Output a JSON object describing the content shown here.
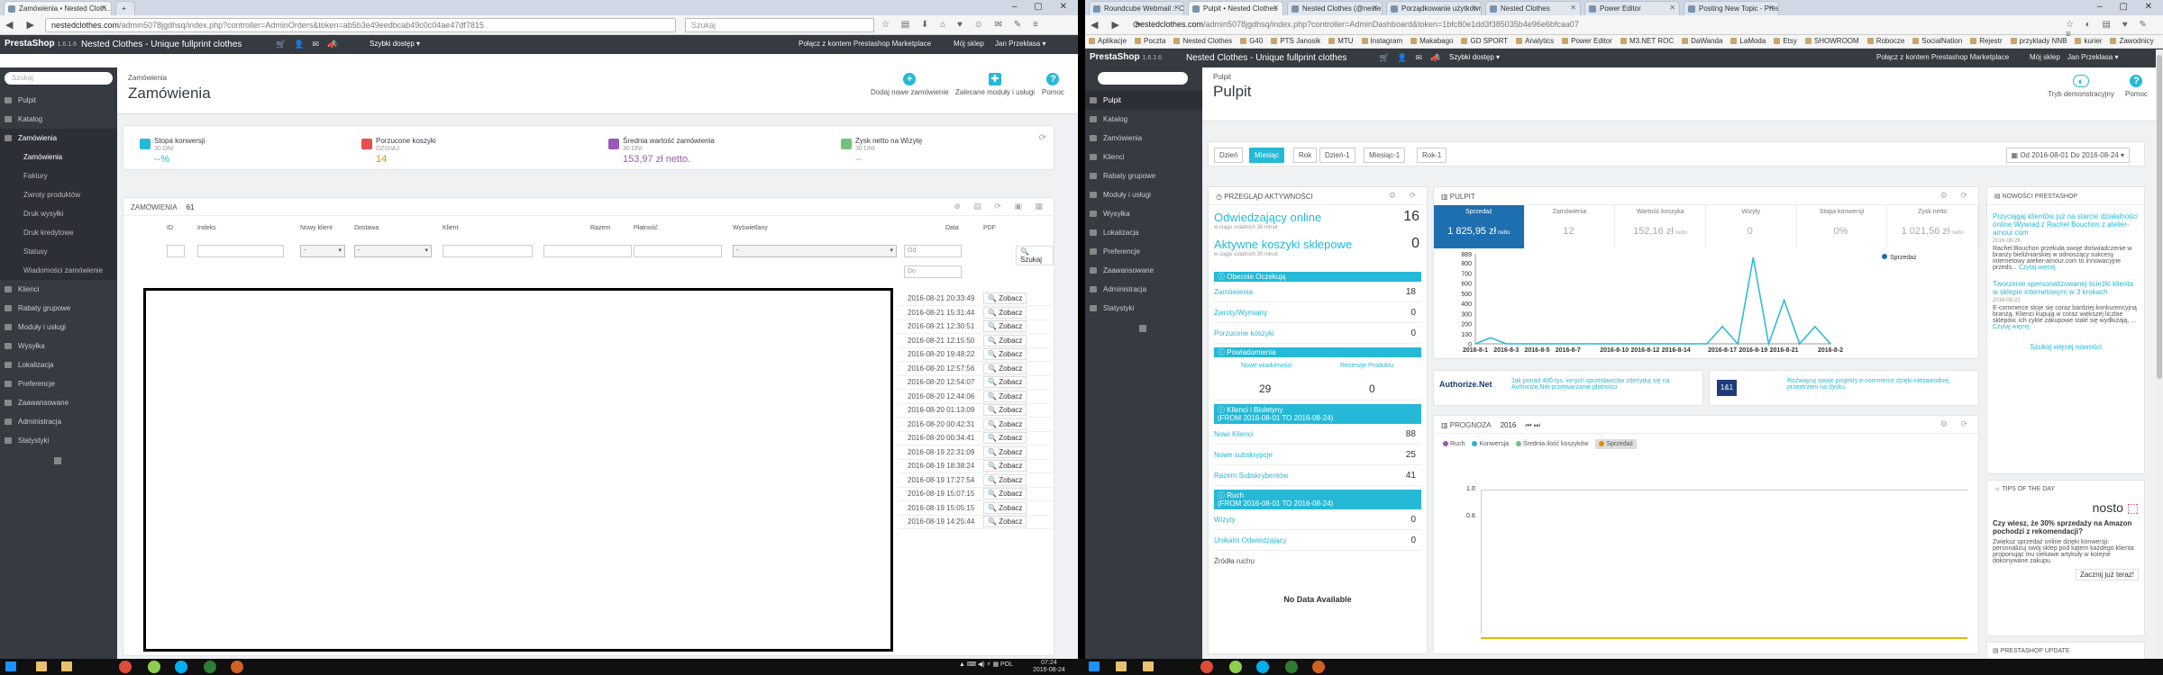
{
  "left_window": {
    "tabs": [
      {
        "label": "Zamówienia • Nested Cloth..."
      }
    ],
    "url_host": "nestedclothes.com",
    "url_path": "/admin5078jgdhsq/index.php?controller=AdminOrders&token=ab5b3e49eedbcab49c0c04ae47df7815",
    "search_placeholder": "Szukaj",
    "ps": {
      "logo": "PrestaShop",
      "version": "1.6.1.6",
      "shop_name": "Nested Clothes - Unique fullprint clothes",
      "quick_access": "Szybki dostęp",
      "marketplace": "Połącz z kontem Prestashop Marketplace",
      "my_shop": "Mój sklep",
      "user": "Jan Przeklasa"
    },
    "sidebar": {
      "search_placeholder": "Szukaj",
      "items": [
        {
          "label": "Pulpit"
        },
        {
          "label": "Katalog"
        },
        {
          "label": "Zamówienia"
        },
        {
          "label": "Klienci"
        },
        {
          "label": "Rabaty grupowe"
        },
        {
          "label": "Moduły i usługi"
        },
        {
          "label": "Wysyłka"
        },
        {
          "label": "Lokalizacja"
        },
        {
          "label": "Preferencje"
        },
        {
          "label": "Zaawansowane"
        },
        {
          "label": "Administracja"
        },
        {
          "label": "Statystyki"
        }
      ],
      "subitems": [
        {
          "label": "Zamówienia"
        },
        {
          "label": "Faktury"
        },
        {
          "label": "Zwroty produktów"
        },
        {
          "label": "Druk wysyłki"
        },
        {
          "label": "Druk kredytowe"
        },
        {
          "label": "Statusy"
        },
        {
          "label": "Wiadomości zamówienie"
        }
      ]
    },
    "page": {
      "breadcrumb": "Zamówienia",
      "title": "Zamówienia",
      "buttons": {
        "add": "Dodaj nowe zamówienie",
        "recommended": "Zalecane moduły i usługi",
        "help": "Pomoc"
      }
    },
    "kpis": [
      {
        "title": "Stopa konwersji",
        "sub": "30 DNI",
        "value": "--%",
        "color": "#25b9d7"
      },
      {
        "title": "Porzucone koszyki",
        "sub": "DZISIAJ",
        "value": "14",
        "color": "#e08f00"
      },
      {
        "title": "Średnia wartość zamówienia",
        "sub": "30 DNI",
        "value": "153,97 zł netto.",
        "color": "#9b59b6"
      },
      {
        "title": "Zysk netto na Wizytę",
        "sub": "30 DNI",
        "value": "--",
        "color": "#72c279"
      }
    ],
    "orders": {
      "title": "ZAMÓWIENIA",
      "count": "61",
      "columns": [
        "ID",
        "Indeks",
        "Nowy klient",
        "Dostawa",
        "Klient",
        "Razem",
        "Płatność",
        "Wyświetlany",
        "Data",
        "PDF"
      ],
      "filter_from": "Od",
      "filter_to": "Do",
      "search_button": "Szukaj",
      "view_label": "Zobacz",
      "dates": [
        "2016-08-21 20:33:49",
        "2016-08-21 15:31:44",
        "2016-08-21 12:30:51",
        "2016-08-21 12:15:50",
        "2016-08-20 19:48:22",
        "2016-08-20 12:57:56",
        "2016-08-20 12:54:07",
        "2016-08-20 12:44:06",
        "2016-08-20 01:13:09",
        "2016-08-20 00:42:31",
        "2016-08-20 00:34:41",
        "2016-08-19 22:31:09",
        "2016-08-19 18:38:24",
        "2016-08-19 17:27:54",
        "2016-08-19 15:07:15",
        "2016-08-19 15:05:15",
        "2016-08-19 14:25:44"
      ]
    }
  },
  "right_window": {
    "tabs": [
      {
        "label": "Roundcube Webmail :: Or..."
      },
      {
        "label": "Pulpit • Nested Clothes"
      },
      {
        "label": "Nested Clothes (@neste..."
      },
      {
        "label": "Porządkowanie użytkowni..."
      },
      {
        "label": "Nested Clothes"
      },
      {
        "label": "Power Editor"
      },
      {
        "label": "Posting New Topic - Pres..."
      }
    ],
    "url_host": "nestedclothes.com",
    "url_path": "/admin5078jgdhsq/index.php?controller=AdminDashboard&token=1bfc80e1dd3f385035b4e96e6bfcaa07",
    "bookmarks": [
      "Aplikacje",
      "Poczta",
      "Nested Clothes",
      "G40",
      "PTS Janosik",
      "MTU",
      "Instagram",
      "Makabago",
      "GD SPORT",
      "Analytics",
      "Power Editor",
      "M3.NET ROC",
      "DaWanda",
      "LaModa",
      "Etsy",
      "SHOWROOM",
      "Robocze",
      "SocialNation",
      "Rejestr",
      "przyklady NNB",
      "kurier",
      "Zawodnicy"
    ],
    "ps": {
      "logo": "PrestaShop",
      "version": "1.6.1.6",
      "shop_name": "Nested Clothes - Unique fullprint clothes",
      "quick_access": "Szybki dostęp",
      "marketplace": "Połącz z kontem Prestashop Marketplace",
      "my_shop": "Mój sklep",
      "user": "Jan Przeklasa"
    },
    "sidebar": {
      "items": [
        {
          "label": "Pulpit"
        },
        {
          "label": "Katalog"
        },
        {
          "label": "Zamówienia"
        },
        {
          "label": "Klienci"
        },
        {
          "label": "Rabaty grupowe"
        },
        {
          "label": "Moduły i usługi"
        },
        {
          "label": "Wysyłka"
        },
        {
          "label": "Lokalizacja"
        },
        {
          "label": "Preferencje"
        },
        {
          "label": "Zaawansowane"
        },
        {
          "label": "Administracja"
        },
        {
          "label": "Statystyki"
        }
      ]
    },
    "page": {
      "breadcrumb": "Pulpit",
      "title": "Pulpit",
      "demo_mode": "Tryb demonstracyjny",
      "help": "Pomoc"
    },
    "range_tabs": [
      "Dzień",
      "Miesiąc",
      "Rok",
      "Dzień-1",
      "Miesiąc-1",
      "Rok-1"
    ],
    "range_label": "Od 2016-08-01 Do 2016-08-24",
    "activity": {
      "title": "PRZEGLĄD AKTYWNOŚCI",
      "online_label": "Odwiedzający online",
      "online_sub": "w ciągu ostatnich 30 minut",
      "online_value": "16",
      "carts_label": "Aktywne koszyki sklepowe",
      "carts_sub": "w ciągu ostatnich 30 minut",
      "carts_value": "0",
      "pending_title": "Obecnie Oczekują",
      "pending": [
        {
          "label": "Zamówienia",
          "value": "18"
        },
        {
          "label": "Zwroty/Wymiany",
          "value": "0"
        },
        {
          "label": "Porzucone koszyki",
          "value": "0"
        }
      ],
      "notif_title": "Powiadomienia",
      "notif_new_msg": "Nowe wiadomości",
      "notif_new_msg_value": "29",
      "notif_reviews": "Recenzje Produktu",
      "notif_reviews_value": "0",
      "customers_title": "Klienci i Biuletyny",
      "customers_range": "(FROM 2016-08-01 TO 2016-08-24)",
      "customers": [
        {
          "label": "Nowi Klienci",
          "value": "88"
        },
        {
          "label": "Nowe subskrypcje",
          "value": "25"
        },
        {
          "label": "Razem Subskrybentów",
          "value": "41"
        }
      ],
      "traffic_title": "Ruch",
      "traffic_range": "(FROM 2016-08-01 TO 2016-08-24)",
      "traffic": [
        {
          "label": "Wizyty",
          "value": "0"
        },
        {
          "label": "Unikalni Odwiedzający",
          "value": "0"
        }
      ],
      "traffic_sources": "Źródła ruchu",
      "no_data": "No Data Available"
    },
    "dashgoals": {
      "title": "PULPIT",
      "cells": [
        {
          "label": "Sprzedaż",
          "value": "1 825,95 zł",
          "unit": "netto"
        },
        {
          "label": "Zamówienia",
          "value": "12",
          "unit": ""
        },
        {
          "label": "Wartość koszyka",
          "value": "152,16 zł",
          "unit": "netto"
        },
        {
          "label": "Wizyty",
          "value": "0",
          "unit": ""
        },
        {
          "label": "Stopa konwersji",
          "value": "0%",
          "unit": ""
        },
        {
          "label": "Zysk netto",
          "value": "1 021,56 zł",
          "unit": "netto"
        }
      ],
      "legend": "Sprzedaż"
    },
    "ads": [
      {
        "brand": "Authorize.Net",
        "text": "Jak ponad 400 tys. innych sprzedawców zdecyduj się na Authorize.Net przetwarzanie płatności"
      },
      {
        "brand": "1&1",
        "text": "Rozwiązuj swoje projekty e-commerce dzięki niezawodnej przestrzeni na dysku"
      }
    ],
    "forecast": {
      "title": "PROGNOZA",
      "year": "2016",
      "legend": [
        "Ruch",
        "Konwersja",
        "Średnia ilość koszyków",
        "Sprzedaż"
      ],
      "ymax_label": "1.0",
      "ymid_label": "0.8"
    },
    "news": {
      "title": "NOWOŚCI PRESTASHOP",
      "items": [
        {
          "headline": "Przyciągaj klientów już na starcie działalności online Wywiad z Rachel Bouchon z atelier-amour.com",
          "date": "2016-08-26",
          "body": "Rachel Bouchon przekuła swoje doświadczenie w branży bieliźniarskiej w odnoszący sukcesy internetowy atelier-amour.com to innowacyjne przeds...",
          "more": "Czytaj więcej"
        },
        {
          "headline": "Tworzenie spersonalizowanej ścieżki klienta w sklepie internetowym w 3 krokach",
          "date": "2016-08-21",
          "body": "E-commerce stoje się coraz bardziej konkurencyjną branżą. Klienci kupują w coraz większej liczbie sklepów, ich cykle zakupowe stale się wydłużają, ...",
          "more": "Czytaj więcej"
        }
      ],
      "find_more": "Szukaj więcej nowości"
    },
    "tips": {
      "title": "TIPS OF THE DAY",
      "brand": "nosto",
      "headline": "Czy wiesz, że 30% sprzedaży na Amazon pochodzi z rekomendacji?",
      "body": "Zwiększ sprzedaż online dzięki konwersji: personalizuj swój sklep pod kątem każdego klienta proponując mu ciekawe artykuły w kolejne dokonywane zakupu.",
      "button": "Zacznij już teraz!"
    },
    "update_title": "PRESTASHOP UPDATE"
  },
  "chart_data": {
    "type": "line",
    "title": "",
    "x": [
      "2016-8-1",
      "2016-8-2",
      "2016-8-3",
      "2016-8-4",
      "2016-8-5",
      "2016-8-6",
      "2016-8-7",
      "2016-8-8",
      "2016-8-9",
      "2016-8-10",
      "2016-8-11",
      "2016-8-12",
      "2016-8-13",
      "2016-8-14",
      "2016-8-15",
      "2016-8-16",
      "2016-8-17",
      "2016-8-18",
      "2016-8-19",
      "2016-8-20",
      "2016-8-21",
      "2016-8-22",
      "2016-8-23",
      "2016-8-24"
    ],
    "tick_labels": [
      "2016-8-1",
      "2016-8-3",
      "2016-8-5",
      "2016-8-7",
      "2016-8-10",
      "2016-8-12",
      "2016-8-14",
      "2016-8-17",
      "2016-8-19",
      "2016-8-21",
      "2016-8-2"
    ],
    "series": [
      {
        "name": "Sprzedaż",
        "color": "#25b9d7",
        "values": [
          0,
          60,
          0,
          0,
          0,
          0,
          0,
          0,
          0,
          0,
          0,
          0,
          0,
          0,
          0,
          0,
          170,
          0,
          850,
          0,
          430,
          0,
          170,
          0
        ]
      }
    ],
    "yticks": [
      "0",
      "100",
      "200",
      "300",
      "400",
      "500",
      "600",
      "700",
      "800",
      "889"
    ],
    "ylim": [
      0,
      889
    ],
    "legend_position": "top-right"
  },
  "taskbar": {
    "time": "07:24",
    "date": "2016-08-24",
    "lang": "POL"
  }
}
